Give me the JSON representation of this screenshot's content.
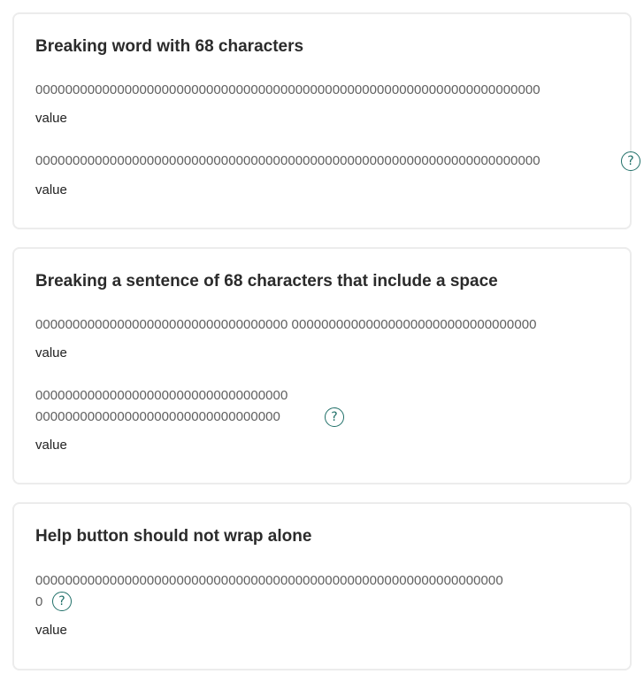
{
  "sections": [
    {
      "title": "Breaking word with 68 characters",
      "fields": [
        {
          "label": "00000000000000000000000000000000000000000000000000000000000000000000",
          "value": "value"
        },
        {
          "label": "00000000000000000000000000000000000000000000000000000000000000000000",
          "value": "value",
          "help": "?"
        }
      ]
    },
    {
      "title": "Breaking a sentence of 68 characters that include a space",
      "fields": [
        {
          "label": "0000000000000000000000000000000000 000000000000000000000000000000000",
          "value": "value"
        },
        {
          "label_line1": "0000000000000000000000000000000000",
          "label_line2": "000000000000000000000000000000000",
          "value": "value",
          "help": "?"
        }
      ]
    },
    {
      "title": "Help button should not wrap alone",
      "fields": [
        {
          "label_line1": "000000000000000000000000000000000000000000000000000000000000000",
          "label_line2": "0",
          "value": "value",
          "help": "?"
        }
      ]
    }
  ]
}
